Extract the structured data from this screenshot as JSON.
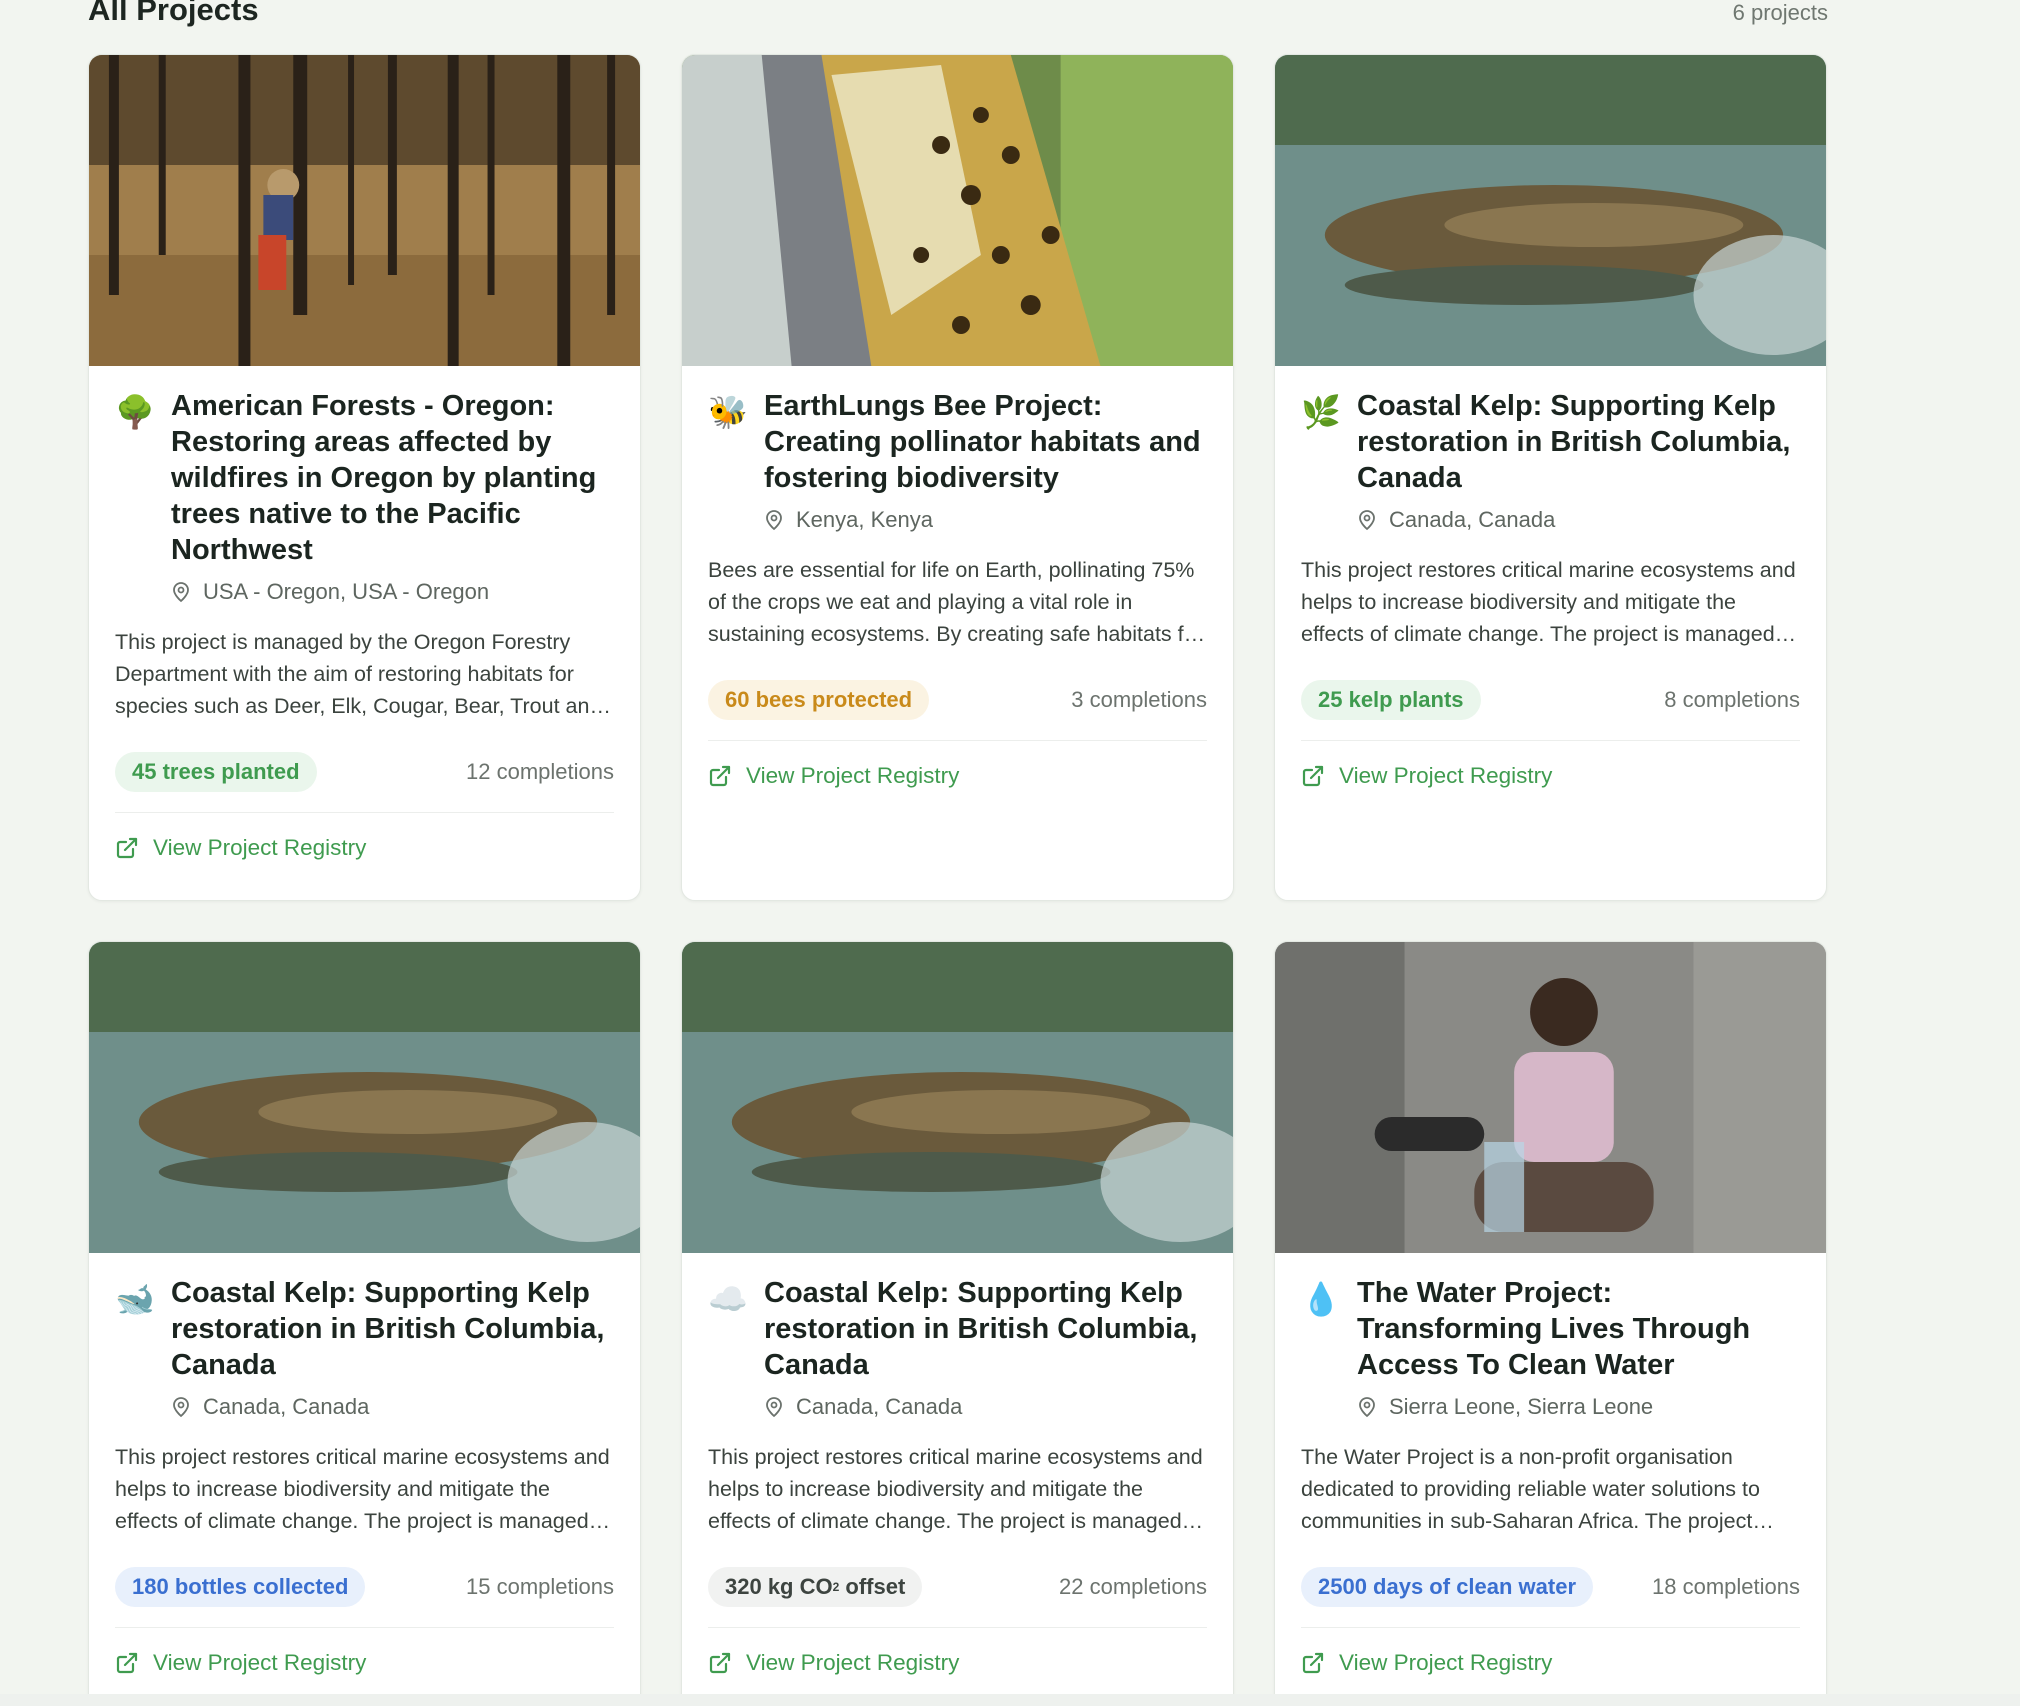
{
  "header": {
    "title": "All Projects",
    "count": "6 projects"
  },
  "link_label": "View Project Registry",
  "colors": {
    "accent_green": "#3f9b4f",
    "amber": "#c98a1a",
    "blue": "#3a6fd0"
  },
  "cards": [
    {
      "icon": "tree-icon",
      "emoji": "🌳",
      "title": "American Forests - Oregon: Restoring areas affected by wildfires in Oregon by planting trees native to the Pacific Northwest",
      "location": "USA - Oregon, USA - Oregon",
      "description": "This project is managed by the Oregon Forestry Department with the aim of restoring habitats for species such as Deer, Elk, Cougar, Bear, Trout and more.",
      "badge": "45 trees planted",
      "completions": "12 completions"
    },
    {
      "icon": "bee-icon",
      "emoji": "🐝",
      "title": "EarthLungs Bee Project: Creating pollinator habitats and fostering biodiversity",
      "location": "Kenya, Kenya",
      "description": "Bees are essential for life on Earth, pollinating 75% of the crops we eat and playing a vital role in sustaining ecosystems. By creating safe habitats for bees",
      "badge": "60 bees protected",
      "completions": "3 completions"
    },
    {
      "icon": "herb-icon",
      "emoji": "🌿",
      "title": "Coastal Kelp: Supporting Kelp restoration in British Columbia, Canada",
      "location": "Canada, Canada",
      "description": "This project restores critical marine ecosystems and helps to increase biodiversity and mitigate the effects of climate change. The project is managed by local partners.",
      "badge": "25 kelp plants",
      "completions": "8 completions"
    },
    {
      "icon": "whale-icon",
      "emoji": "🐋",
      "title": "Coastal Kelp: Supporting Kelp restoration in British Columbia, Canada",
      "location": "Canada, Canada",
      "description": "This project restores critical marine ecosystems and helps to increase biodiversity and mitigate the effects of climate change. The project is managed by local partners.",
      "badge": "180 bottles collected",
      "completions": "15 completions"
    },
    {
      "icon": "cloud-icon",
      "emoji": "☁️",
      "title": "Coastal Kelp: Supporting Kelp restoration in British Columbia, Canada",
      "location": "Canada, Canada",
      "description": "This project restores critical marine ecosystems and helps to increase biodiversity and mitigate the effects of climate change. The project is managed by local partners.",
      "badge_main": "320 kg CO",
      "badge_sub": "2",
      "badge_tail": " offset",
      "completions": "22 completions"
    },
    {
      "icon": "droplet-icon",
      "emoji": "💧",
      "title": "The Water Project: Transforming Lives Through Access To Clean Water",
      "location": "Sierra Leone, Sierra Leone",
      "description": "The Water Project is a non-profit organisation dedicated to providing reliable water solutions to communities in sub-Saharan Africa. The project works with local partners.",
      "badge": "2500 days of clean water",
      "completions": "18 completions"
    }
  ]
}
